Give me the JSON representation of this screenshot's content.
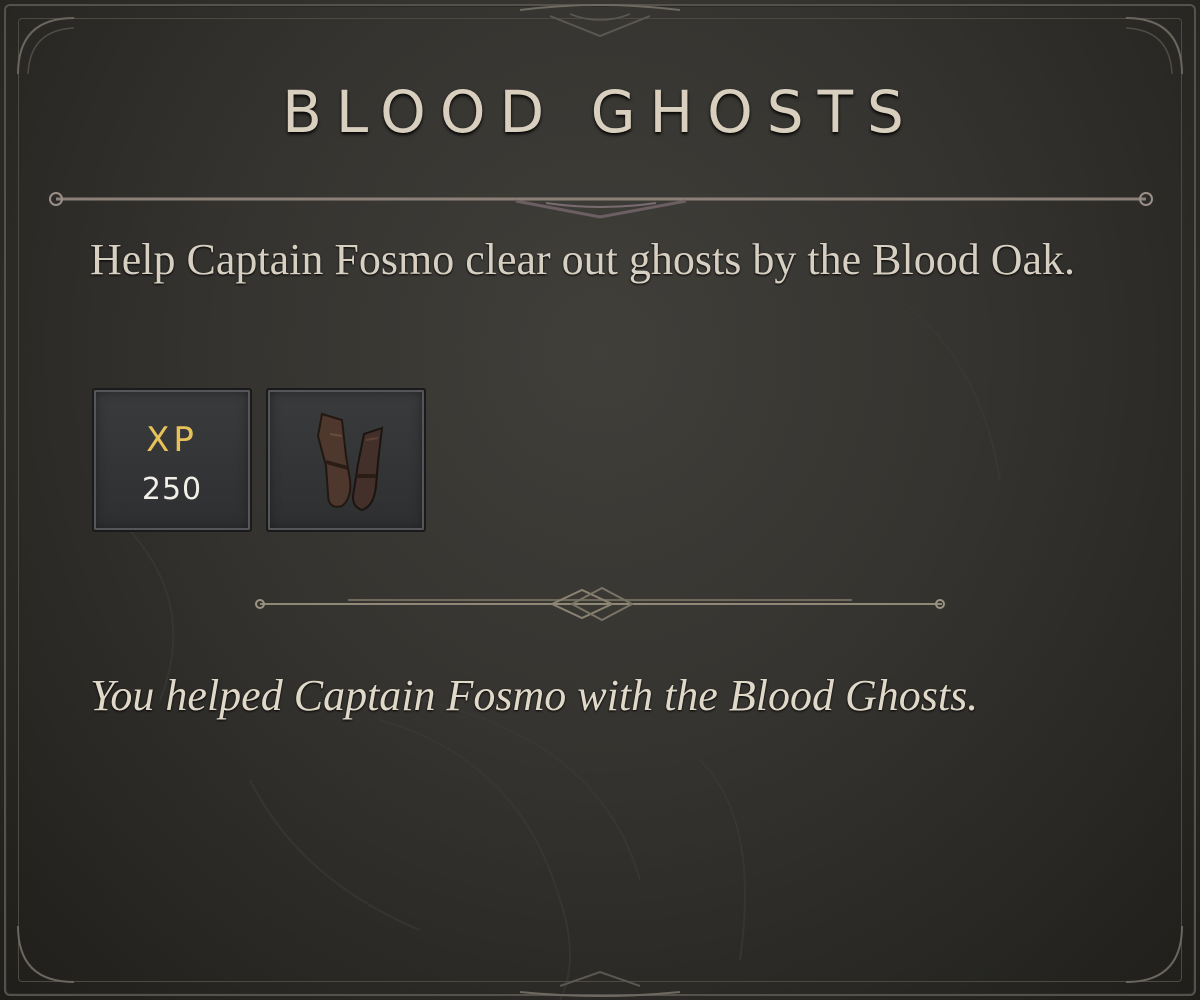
{
  "quest": {
    "title": "BLOOD GHOSTS",
    "description": "Help Captain Fosmo clear out ghosts by the Blood Oak.",
    "completion_text": "You helped Captain Fosmo with the Blood Ghosts."
  },
  "rewards": [
    {
      "type": "xp",
      "label": "XP",
      "value": "250",
      "label_color": "#e7c25a"
    },
    {
      "type": "item",
      "icon": "gauntlets-icon"
    }
  ],
  "colors": {
    "panel_background": "#35332f",
    "frame": "#55524b",
    "title_text": "#d8cfbf",
    "body_text": "#d6cfc2",
    "accent_gold": "#e7c25a"
  }
}
